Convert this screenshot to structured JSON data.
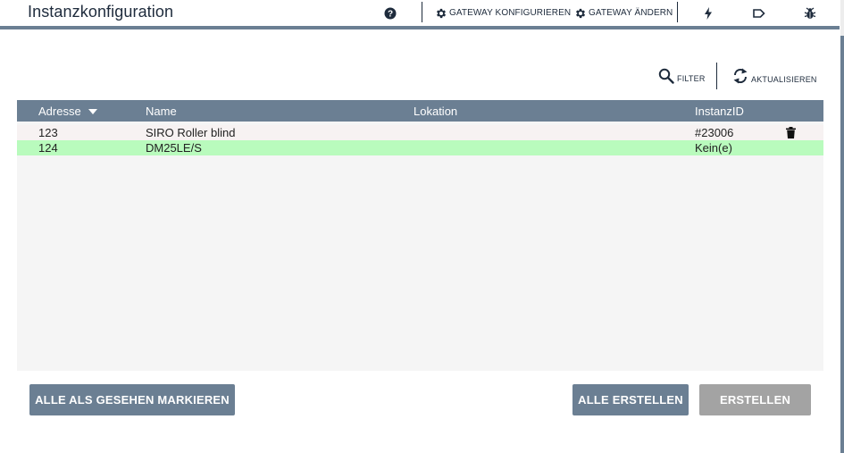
{
  "header": {
    "title": "Instanzkonfiguration",
    "help_icon": "help-circle-icon",
    "configure_gateway": "GATEWAY KONFIGURIEREN",
    "change_gateway": "GATEWAY ÄNDERN",
    "icons": [
      "flash-icon",
      "label-icon",
      "bug-icon"
    ]
  },
  "toolbar": {
    "filter": "FILTER",
    "refresh": "AKTUALISIEREN"
  },
  "table": {
    "columns": [
      "Adresse",
      "Name",
      "Lokation",
      "InstanzID"
    ],
    "rows": [
      {
        "address": "123",
        "name": "SIRO Roller blind",
        "location": "",
        "instance_id": "#23006",
        "has_delete": true,
        "highlight": false
      },
      {
        "address": "124",
        "name": "DM25LE/S",
        "location": "",
        "instance_id": "Kein(e)",
        "has_delete": false,
        "highlight": true
      }
    ]
  },
  "buttons": {
    "mark_all_seen": "ALLE ALS GESEHEN MARKIEREN",
    "create_all": "ALLE ERSTELLEN",
    "create": "ERSTELLEN"
  },
  "colors": {
    "accent": "#6b7f93",
    "highlight_row": "#b9fbbd",
    "disabled_button": "#a3a3a3",
    "title_text": "#1e2b3c"
  }
}
